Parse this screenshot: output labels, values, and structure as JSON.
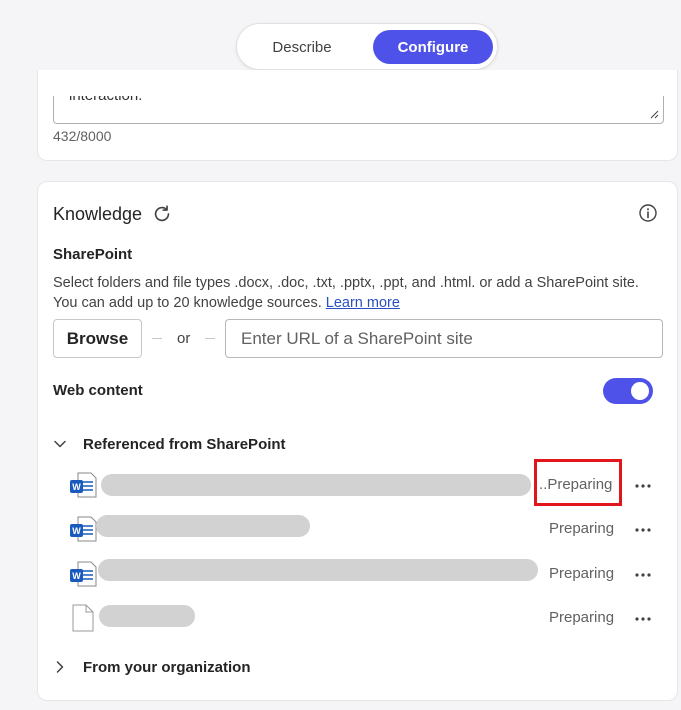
{
  "tabs": {
    "describe_label": "Describe",
    "configure_label": "Configure",
    "active": "Configure"
  },
  "instructions": {
    "cut_text": "interaction.",
    "char_count": "432/8000"
  },
  "knowledge": {
    "title": "Knowledge",
    "sharepoint": {
      "label": "SharePoint",
      "description": "Select folders and file types .docx, .doc, .txt, .pptx, .ppt, and .html. or add a SharePoint site. You can add up to 20 knowledge sources.",
      "learn_more": "Learn more",
      "browse_label": "Browse",
      "or_label": "or",
      "url_placeholder": "Enter URL of a SharePoint site"
    },
    "web_content": {
      "label": "Web content",
      "enabled": true
    },
    "referenced_group": {
      "label": "Referenced from SharePoint",
      "expanded": true,
      "files": [
        {
          "type": "word",
          "status": "..Preparing"
        },
        {
          "type": "word",
          "status": "Preparing"
        },
        {
          "type": "word",
          "status": "Preparing"
        },
        {
          "type": "text",
          "status": "Preparing"
        }
      ]
    },
    "org_group": {
      "label": "From your organization",
      "expanded": false
    }
  },
  "colors": {
    "accent": "#4f52e8",
    "highlight": "#e0161b",
    "word_blue": "#185abd"
  }
}
